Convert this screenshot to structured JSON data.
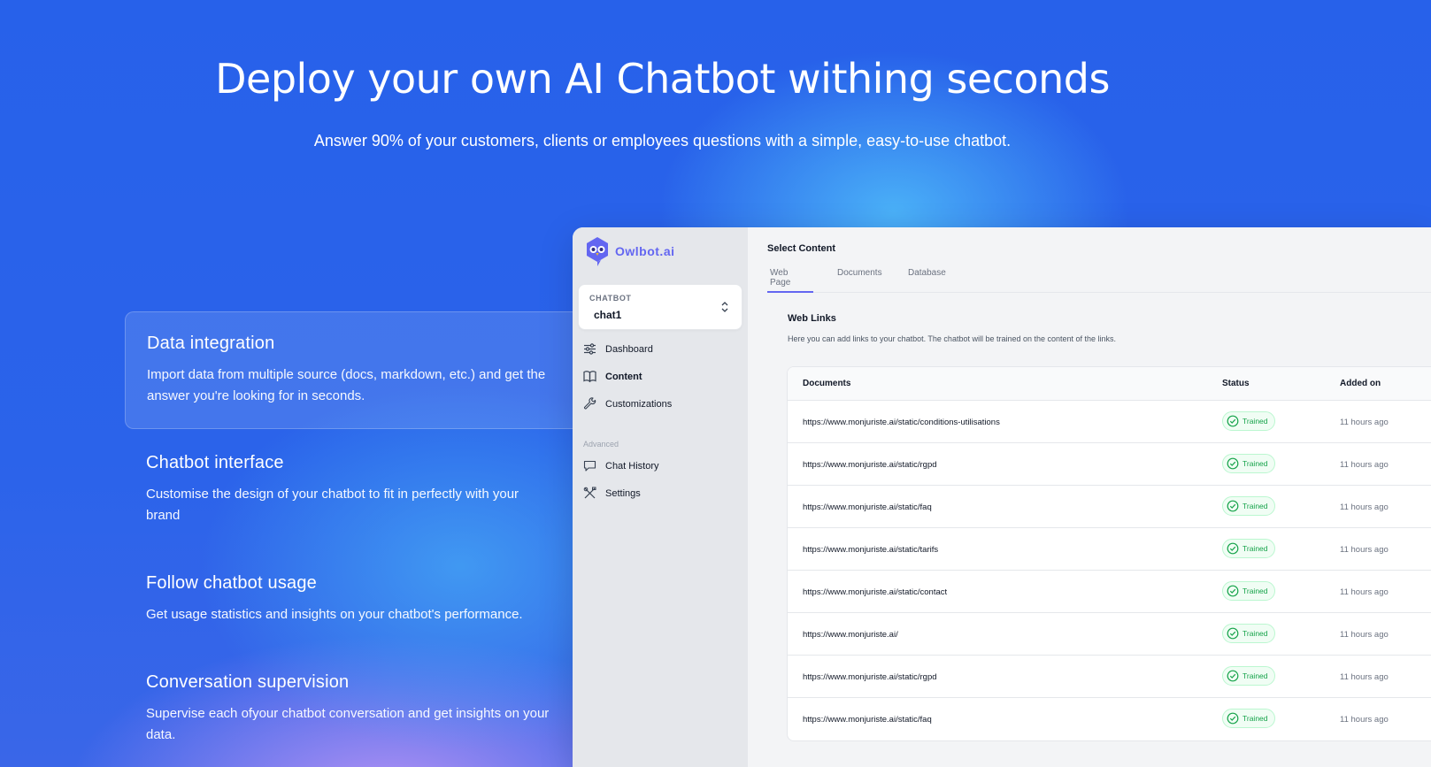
{
  "hero": {
    "title": "Deploy your own AI Chatbot withing seconds",
    "subtitle": "Answer 90% of your customers, clients or employees questions with a simple, easy-to-use chatbot."
  },
  "features": [
    {
      "title": "Data integration",
      "description": "Import data from multiple source (docs, markdown, etc.) and get the answer you're looking for in seconds.",
      "active": true
    },
    {
      "title": "Chatbot interface",
      "description": "Customise the design of your chatbot to fit in perfectly with your brand",
      "active": false
    },
    {
      "title": "Follow chatbot usage",
      "description": "Get usage statistics and insights on your chatbot's performance.",
      "active": false
    },
    {
      "title": "Conversation supervision",
      "description": "Supervise each ofyour chatbot conversation and get insights on your data.",
      "active": false
    }
  ],
  "app": {
    "brand": "Owlbot.ai",
    "chatbot_select": {
      "label": "CHATBOT",
      "value": "chat1"
    },
    "nav": [
      {
        "label": "Dashboard",
        "icon": "sliders-icon"
      },
      {
        "label": "Content",
        "icon": "book-icon",
        "active": true
      },
      {
        "label": "Customizations",
        "icon": "wrench-icon"
      }
    ],
    "advanced_label": "Advanced",
    "advanced_nav": [
      {
        "label": "Chat History",
        "icon": "chat-icon"
      },
      {
        "label": "Settings",
        "icon": "tools-icon"
      }
    ],
    "main": {
      "title": "Select Content",
      "tabs": [
        "Web Page",
        "Documents",
        "Database"
      ],
      "active_tab": "Web Page",
      "section_title": "Web Links",
      "section_description": "Here you can add links to your chatbot. The chatbot will be trained on the content of the links.",
      "table": {
        "headers": [
          "Documents",
          "Status",
          "Added on"
        ],
        "rows": [
          {
            "url": "https://www.monjuriste.ai/static/conditions-utilisations",
            "status": "Trained",
            "added": "11 hours ago"
          },
          {
            "url": "https://www.monjuriste.ai/static/rgpd",
            "status": "Trained",
            "added": "11 hours ago"
          },
          {
            "url": "https://www.monjuriste.ai/static/faq",
            "status": "Trained",
            "added": "11 hours ago"
          },
          {
            "url": "https://www.monjuriste.ai/static/tarifs",
            "status": "Trained",
            "added": "11 hours ago"
          },
          {
            "url": "https://www.monjuriste.ai/static/contact",
            "status": "Trained",
            "added": "11 hours ago"
          },
          {
            "url": "https://www.monjuriste.ai/",
            "status": "Trained",
            "added": "11 hours ago"
          },
          {
            "url": "https://www.monjuriste.ai/static/rgpd",
            "status": "Trained",
            "added": "11 hours ago"
          },
          {
            "url": "https://www.monjuriste.ai/static/faq",
            "status": "Trained",
            "added": "11 hours ago"
          }
        ]
      }
    }
  },
  "colors": {
    "background": "#2a62ea",
    "accent": "#6366f1",
    "success": "#16a34a"
  }
}
